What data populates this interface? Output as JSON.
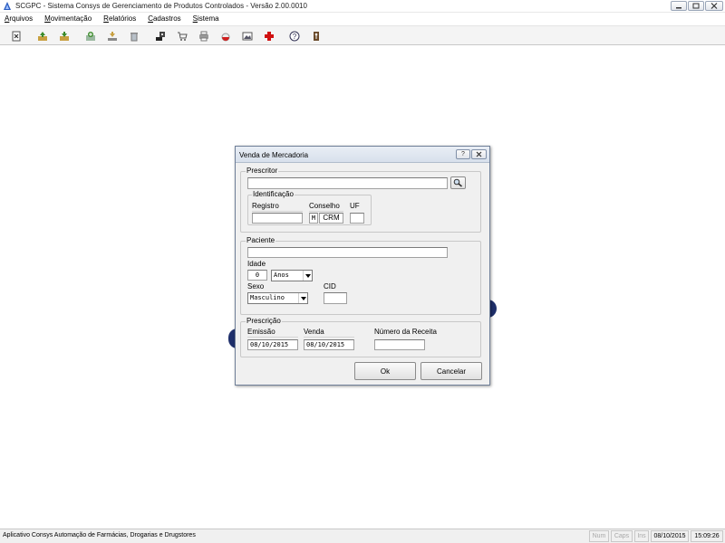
{
  "window": {
    "title": "SCGPC - Sistema Consys de Gerenciamento de Produtos Controlados - Versão 2.00.0010"
  },
  "menu": {
    "items": [
      {
        "u": "A",
        "rest": "rquivos"
      },
      {
        "u": "M",
        "rest": "ovimentação"
      },
      {
        "u": "R",
        "rest": "elatórios"
      },
      {
        "u": "C",
        "rest": "adastros"
      },
      {
        "u": "S",
        "rest": "istema"
      }
    ]
  },
  "toolbar": {
    "icons": [
      "close-file-icon",
      "add-entry-icon",
      "add-exit-icon",
      "add-record-icon",
      "download-icon",
      "trash-icon",
      "stamp-icon",
      "cart-icon",
      "print-icon",
      "pill-icon",
      "image-icon",
      "red-cross-icon",
      "help-icon",
      "exit-icon"
    ]
  },
  "dialog": {
    "title": "Venda de Mercadoria",
    "help_btn": "?",
    "prescritor": {
      "label": "Prescritor",
      "name_value": "",
      "identificacao_label": "Identificação",
      "registro_label": "Registro",
      "registro_value": "",
      "conselho_label": "Conselho",
      "conselho_code": "M",
      "conselho_value": "CRM",
      "uf_label": "UF",
      "uf_value": ""
    },
    "paciente": {
      "label": "Paciente",
      "name_value": "",
      "idade_label": "Idade",
      "idade_value": "0",
      "idade_unit": "Anos",
      "sexo_label": "Sexo",
      "sexo_value": "Masculino",
      "cid_label": "CID",
      "cid_value": ""
    },
    "prescricao": {
      "label": "Prescrição",
      "emissao_label": "Emissão",
      "emissao_value": "08/10/2015",
      "venda_label": "Venda",
      "venda_value": "08/10/2015",
      "numero_label": "Número da Receita",
      "numero_value": ""
    },
    "ok_label": "Ok",
    "cancel_label": "Cancelar"
  },
  "statusbar": {
    "text": "Aplicativo Consys Automação de Farmácias, Drogarias e Drugstores",
    "num": "Num",
    "caps": "Caps",
    "ins": "Ins",
    "date": "08/10/2015",
    "time": "15:09:26"
  },
  "colors": {
    "accent": "#1f2f6b",
    "close_red": "#d01010",
    "icon_green": "#3a8a2a"
  }
}
